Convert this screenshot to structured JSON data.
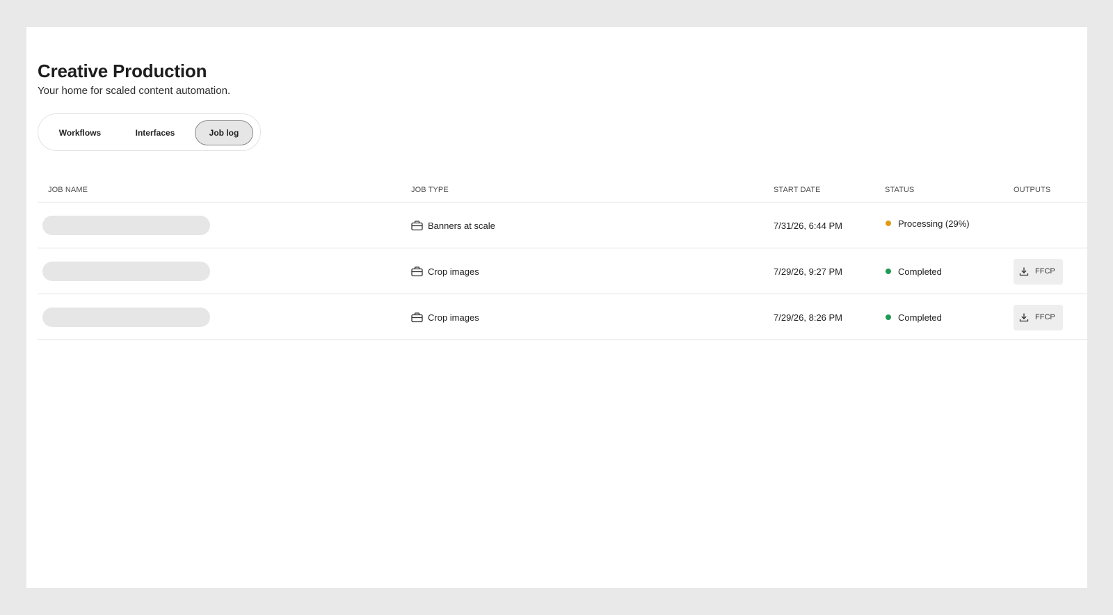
{
  "header": {
    "title": "Creative Production",
    "subtitle": "Your home for scaled content automation."
  },
  "tabs": [
    {
      "label": "Workflows",
      "active": false
    },
    {
      "label": "Interfaces",
      "active": false
    },
    {
      "label": "Job log",
      "active": true
    }
  ],
  "table": {
    "columns": [
      "JOB NAME",
      "JOB TYPE",
      "START DATE",
      "STATUS",
      "OUTPUTS"
    ],
    "rows": [
      {
        "job_type": "Banners at scale",
        "type_icon": "briefcase-icon",
        "start_date": "7/31/26, 6:44 PM",
        "status": "Processing (29%)",
        "status_color": "#e09b14",
        "output": ""
      },
      {
        "job_type": "Crop images",
        "type_icon": "briefcase-icon",
        "start_date": "7/29/26, 9:27 PM",
        "status": "Completed",
        "status_color": "#1f9a55",
        "output": "FFCP"
      },
      {
        "job_type": "Crop images",
        "type_icon": "briefcase-icon",
        "start_date": "7/29/26, 8:26 PM",
        "status": "Completed",
        "status_color": "#1f9a55",
        "output": "FFCP"
      }
    ]
  },
  "colors": {
    "background": "#e9e9e9",
    "card": "#ffffff",
    "active_tab": "#e6e6e6",
    "skeleton": "#e6e6e6",
    "processing": "#e09b14",
    "completed": "#1f9a55"
  }
}
